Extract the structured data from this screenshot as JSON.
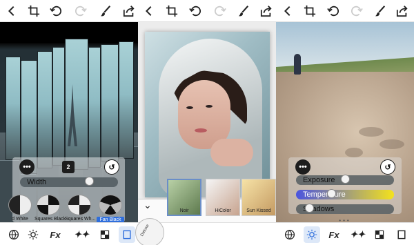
{
  "app": {
    "top_icons": [
      "back-chevron",
      "crop",
      "undo",
      "redo",
      "brush",
      "share"
    ],
    "bottom_icons": [
      "globe",
      "adjust-sun",
      "fx",
      "sparkles",
      "checker",
      "frame"
    ]
  },
  "left_panel": {
    "slider_label": "Width",
    "slider_value": 0.73,
    "badge": "2",
    "presets": [
      {
        "label": "d White",
        "selected": false
      },
      {
        "label": "Squares Black",
        "selected": false
      },
      {
        "label": "Squares Wh...",
        "selected": false
      },
      {
        "label": "Fan Black",
        "selected": true
      }
    ]
  },
  "middle_panel": {
    "filters": [
      {
        "label": "Noir"
      },
      {
        "label": "HiColor"
      },
      {
        "label": "Sun Kissed"
      }
    ],
    "dial_label": "Deluxe"
  },
  "right_panel": {
    "sliders": [
      {
        "label": "Exposure",
        "value": 0.5
      },
      {
        "label": "Temperature",
        "value": 0.35
      },
      {
        "label": "Shadows",
        "value": 0.1
      }
    ]
  },
  "colors": {
    "accent": "#2e6edc",
    "temperature_start": "#4a54e0",
    "temperature_end": "#f4e21c"
  }
}
